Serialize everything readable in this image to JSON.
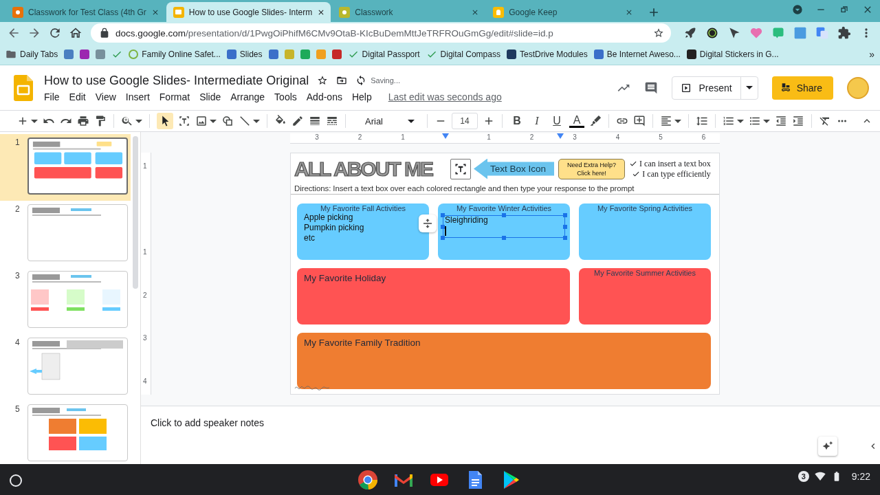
{
  "browser": {
    "tabs": [
      {
        "title": "Classwork for Test Class (4th Gr",
        "kind": "classroom",
        "color": "#e8710a",
        "selected": false
      },
      {
        "title": "How to use Google Slides- Interm",
        "kind": "slides",
        "color": "#f4b400",
        "selected": true
      },
      {
        "title": "Classwork",
        "kind": "classroom",
        "color": "#b8b82c",
        "selected": false
      },
      {
        "title": "Google Keep",
        "kind": "keep",
        "color": "#fbbc04",
        "selected": false
      }
    ],
    "address": {
      "host": "docs.google.com",
      "path": "/presentation/d/1PwgOiPhifM6CMv9OtaB-KIcBuDemMttJeTRFROuGmGg/edit#slide=id.p"
    },
    "bookmarks": [
      {
        "label": "Daily Tabs",
        "kind": "folder",
        "color": "#5f6368"
      },
      {
        "kind": "site",
        "color": "#4a7fc1"
      },
      {
        "kind": "site",
        "color": "#9c27b0"
      },
      {
        "kind": "site",
        "color": "#78909c"
      },
      {
        "kind": "check",
        "color": "#2e9b50"
      },
      {
        "label": "Family Online Safet...",
        "kind": "ring",
        "color": "#7cb342"
      },
      {
        "label": "Slides",
        "kind": "site",
        "color": "#3b6fc9"
      },
      {
        "kind": "site",
        "color": "#3b6fc9"
      },
      {
        "kind": "site",
        "color": "#c7b52a"
      },
      {
        "kind": "site",
        "color": "#1eaa5a"
      },
      {
        "kind": "site",
        "color": "#f0a020"
      },
      {
        "kind": "site",
        "color": "#c62828"
      },
      {
        "label": "Digital Passport",
        "kind": "check",
        "color": "#2e9b50"
      },
      {
        "label": "Digital Compass",
        "kind": "check",
        "color": "#2e9b50"
      },
      {
        "label": "TestDrive Modules",
        "kind": "site",
        "color": "#1e3a5f"
      },
      {
        "label": "Be Internet Aweso...",
        "kind": "site",
        "color": "#3b6fc9"
      },
      {
        "label": "Digital Stickers in G...",
        "kind": "site",
        "color": "#222222"
      }
    ],
    "bookmarks_overflow": "»"
  },
  "document": {
    "title": "How to use Google Slides- Intermediate Original",
    "status": "Saving...",
    "menus": [
      "File",
      "Edit",
      "View",
      "Insert",
      "Format",
      "Slide",
      "Arrange",
      "Tools",
      "Add-ons",
      "Help"
    ],
    "last_edit": "Last edit was seconds ago",
    "present_label": "Present",
    "share_label": "Share"
  },
  "toolbar": {
    "font": "Arial",
    "font_size": "14",
    "format_buttons": [
      {
        "label": "B",
        "kind": "bold"
      },
      {
        "label": "I",
        "kind": "italic"
      },
      {
        "label": "U",
        "kind": "underline"
      },
      {
        "label": "A",
        "kind": "text-color"
      }
    ]
  },
  "ruler": {
    "horizontal": [
      "3",
      "2",
      "1",
      "1",
      "2",
      "3",
      "4",
      "5",
      "6"
    ],
    "vertical": [
      "1",
      "1",
      "2",
      "3",
      "4"
    ]
  },
  "filmstrip": {
    "slides": [
      {
        "number": "1",
        "kind": "boxes",
        "selected": true
      },
      {
        "number": "2",
        "kind": "blank",
        "selected": false
      },
      {
        "number": "3",
        "kind": "images",
        "selected": false
      },
      {
        "number": "4",
        "kind": "screenshot",
        "selected": false
      },
      {
        "number": "5",
        "kind": "cards",
        "selected": false
      }
    ]
  },
  "slide": {
    "title": "ALL ABOUT ME",
    "callout": "Text Box Icon",
    "help_button": [
      "Need Extra Help?",
      "Click here!"
    ],
    "goals": [
      "I can insert a text box",
      "I can type efficiently"
    ],
    "directions": "Directions: Insert a text box over each colored rectangle and then type your response to the prompt",
    "boxes": [
      {
        "title": "My Favorite Fall Activities",
        "kind": "single",
        "color": "#66ccff",
        "text_box": {
          "lines": [
            "Apple picking",
            "Pumpkin picking",
            "etc"
          ],
          "selected": false
        }
      },
      {
        "title": "My Favorite Winter Activities",
        "kind": "single",
        "color": "#66ccff",
        "text_box": {
          "lines": [
            "Sleighriding"
          ],
          "selected": true
        }
      },
      {
        "title": "My Favorite Spring Activities",
        "kind": "single",
        "color": "#66ccff"
      },
      {
        "title": "My Favorite Holiday",
        "kind": "double",
        "color": "#ff5353"
      },
      {
        "title": "My Favorite Summer Activities",
        "kind": "single",
        "color": "#ff5353"
      },
      {
        "title": "My Favorite Family Tradition",
        "kind": "triple",
        "color": "#ef7d31"
      }
    ]
  },
  "speaker_notes": {
    "placeholder": "Click to add speaker notes"
  },
  "shelf": {
    "notification_count": "3",
    "time": "9:22"
  }
}
